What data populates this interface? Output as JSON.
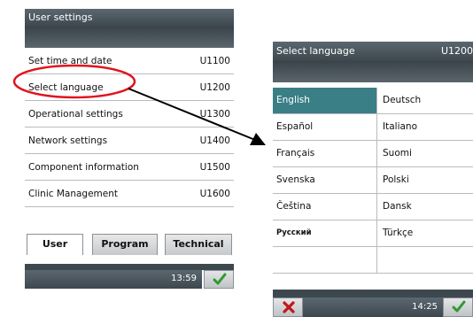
{
  "left_panel": {
    "title": "User settings",
    "menu": [
      {
        "label": "Set time and date",
        "code": "U1100"
      },
      {
        "label": "Select language",
        "code": "U1200"
      },
      {
        "label": "Operational settings",
        "code": "U1300"
      },
      {
        "label": "Network settings",
        "code": "U1400"
      },
      {
        "label": "Component information",
        "code": "U1500"
      },
      {
        "label": "Clinic Management",
        "code": "U1600"
      }
    ],
    "tabs": [
      {
        "label": "User",
        "active": true
      },
      {
        "label": "Program",
        "active": false
      },
      {
        "label": "Technical",
        "active": false
      }
    ],
    "time": "13:59",
    "ok_icon": "check-icon"
  },
  "right_panel": {
    "title": "Select language",
    "code": "U1200",
    "languages_left": [
      "English",
      "Español",
      "Français",
      "Svenska",
      "Čeština",
      "Русский",
      ""
    ],
    "languages_right": [
      "Deutsch",
      "Italiano",
      "Suomi",
      "Polski",
      "Dansk",
      "Türkçe",
      ""
    ],
    "selected": "English",
    "time": "14:25",
    "cancel_icon": "x-icon",
    "ok_icon": "check-icon"
  },
  "colors": {
    "titlebar": "#4a555c",
    "selected_cell": "#3a7f86",
    "highlight_circle": "#e0141e",
    "check": "#2e9a2e",
    "cancel": "#c0171c"
  }
}
